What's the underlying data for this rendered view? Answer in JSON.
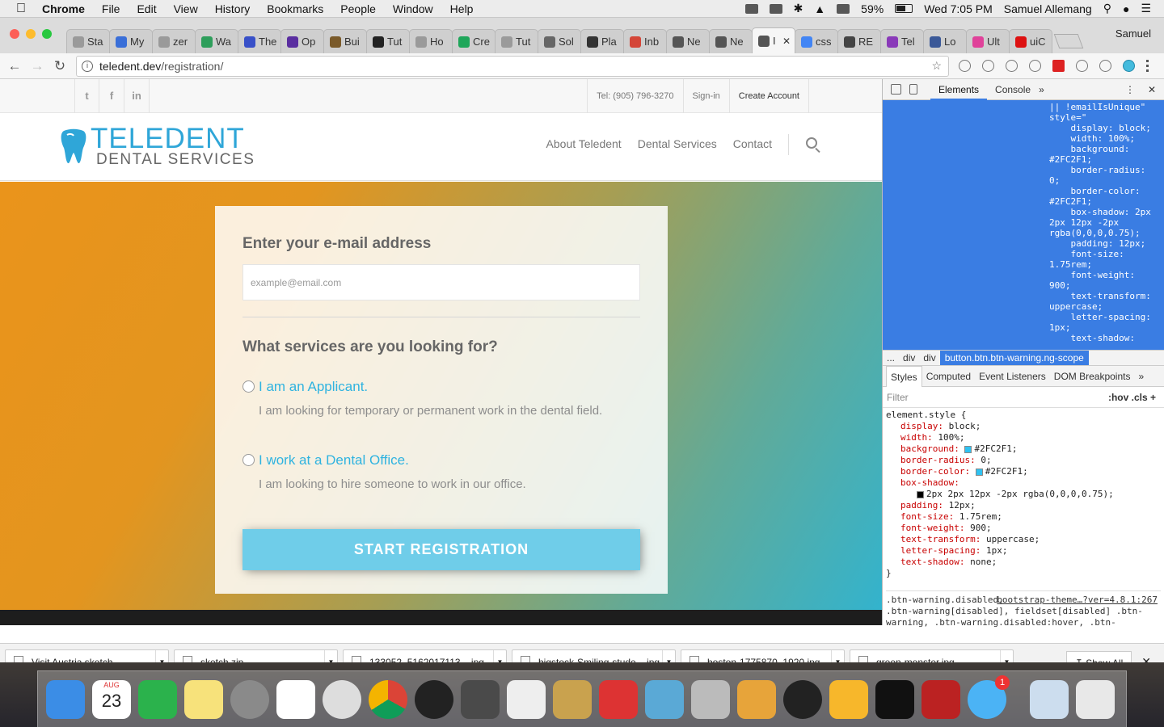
{
  "menubar": {
    "app": "Chrome",
    "items": [
      "File",
      "Edit",
      "View",
      "History",
      "Bookmarks",
      "People",
      "Window",
      "Help"
    ],
    "battery": "59%",
    "clock": "Wed 7:05 PM",
    "user": "Samuel Allemang"
  },
  "tabs": [
    {
      "label": "Sta",
      "color": "#9a9a9a"
    },
    {
      "label": "My",
      "color": "#3a6fd8"
    },
    {
      "label": "zer",
      "color": "#9a9a9a"
    },
    {
      "label": "Wa",
      "color": "#2e9e5b"
    },
    {
      "label": "The",
      "color": "#3850c8"
    },
    {
      "label": "Op",
      "color": "#5a2ea0"
    },
    {
      "label": "Bui",
      "color": "#7a5a2a"
    },
    {
      "label": "Tut",
      "color": "#222222"
    },
    {
      "label": "Ho",
      "color": "#9a9a9a"
    },
    {
      "label": "Cre",
      "color": "#1fa65a"
    },
    {
      "label": "Tut",
      "color": "#9a9a9a"
    },
    {
      "label": "Sol",
      "color": "#666666"
    },
    {
      "label": "Pla",
      "color": "#333333"
    },
    {
      "label": "Inb",
      "color": "#d44638"
    },
    {
      "label": "Ne",
      "color": "#555555"
    },
    {
      "label": "Ne",
      "color": "#555555"
    },
    {
      "label": "I",
      "color": "#555555",
      "active": true
    },
    {
      "label": "css",
      "color": "#4285f4"
    },
    {
      "label": "RE",
      "color": "#444444"
    },
    {
      "label": "Tel",
      "color": "#8a3ab9"
    },
    {
      "label": "Lo",
      "color": "#3b5998"
    },
    {
      "label": "Ult",
      "color": "#e0429a"
    },
    {
      "label": "uiC",
      "color": "#dd1111"
    }
  ],
  "profile": "Samuel",
  "address": {
    "host": "teledent.dev",
    "path": "/registration/"
  },
  "site": {
    "social": [
      "t",
      "f",
      "in"
    ],
    "topbar": {
      "tel": "Tel: (905) 796-3270",
      "signin": "Sign-in",
      "create": "Create Account"
    },
    "logo": {
      "line1": "TELEDENT",
      "line2": "DENTAL SERVICES"
    },
    "nav": [
      "About Teledent",
      "Dental Services",
      "Contact"
    ],
    "form": {
      "email_heading": "Enter your e-mail address",
      "email_placeholder": "example@email.com",
      "services_heading": "What services are you looking for?",
      "options": [
        {
          "title": "I am an Applicant.",
          "desc": "I am looking for temporary or permanent work in the dental field."
        },
        {
          "title": "I work at a Dental Office.",
          "desc": "I am looking to hire someone to work in our office."
        }
      ],
      "button": "START REGISTRATION"
    }
  },
  "devtools": {
    "tabs": [
      "Elements",
      "Console"
    ],
    "code": "|| !emailIsUnique\"\nstyle=\"\n    display: block;\n    width: 100%;\n    background:\n#2FC2F1;\n    border-radius:\n0;\n    border-color:\n#2FC2F1;\n    box-shadow: 2px\n2px 12px -2px\nrgba(0,0,0,0.75);\n    padding: 12px;\n    font-size:\n1.75rem;\n    font-weight:\n900;\n    text-transform:\nuppercase;\n    letter-spacing:\n1px;\n    text-shadow:",
    "crumbs": [
      "...",
      "div",
      "div"
    ],
    "crumb_selected": "button.btn.btn-warning.ng-scope",
    "subtabs": [
      "Styles",
      "Computed",
      "Event Listeners",
      "DOM Breakpoints"
    ],
    "filter": "Filter",
    "hov": ":hov  .cls  +",
    "element_style": "element.style {",
    "props": [
      {
        "n": "display",
        "v": "block;"
      },
      {
        "n": "width",
        "v": "100%;"
      },
      {
        "n": "background",
        "v": "#2FC2F1;",
        "sw": true
      },
      {
        "n": "border-radius",
        "v": "0;"
      },
      {
        "n": "border-color",
        "v": "#2FC2F1;",
        "sw": true
      },
      {
        "n": "box-shadow",
        "v": ""
      },
      {
        "n": "",
        "v": "2px 2px 12px -2px  rgba(0,0,0,0.75);",
        "indent": true
      },
      {
        "n": "padding",
        "v": "12px;"
      },
      {
        "n": "font-size",
        "v": "1.75rem;"
      },
      {
        "n": "font-weight",
        "v": "900;"
      },
      {
        "n": "text-transform",
        "v": "uppercase;"
      },
      {
        "n": "letter-spacing",
        "v": "1px;"
      },
      {
        "n": "text-shadow",
        "v": "none;"
      }
    ],
    "close_brace": "}",
    "rule2_selector": ".btn-warning.disabled,\n.btn-warning[disabled], fieldset[disabled] .btn-warning, .btn-warning.disabled:hover, .btn-",
    "rule2_source": "bootstrap-theme…?ver=4.8.1:267"
  },
  "downloads": [
    {
      "name": "Visit Austria.sketch"
    },
    {
      "name": "sketch.zip"
    },
    {
      "name": "133052_5162017113....jpg"
    },
    {
      "name": "bigstock-Smiling-stude....jpg"
    },
    {
      "name": "boston-1775870_1920.jpg"
    },
    {
      "name": "green-monster.jpg"
    }
  ],
  "show_all": "Show All",
  "dock_calendar": {
    "month": "AUG",
    "day": "23"
  },
  "dock_badge": "1"
}
